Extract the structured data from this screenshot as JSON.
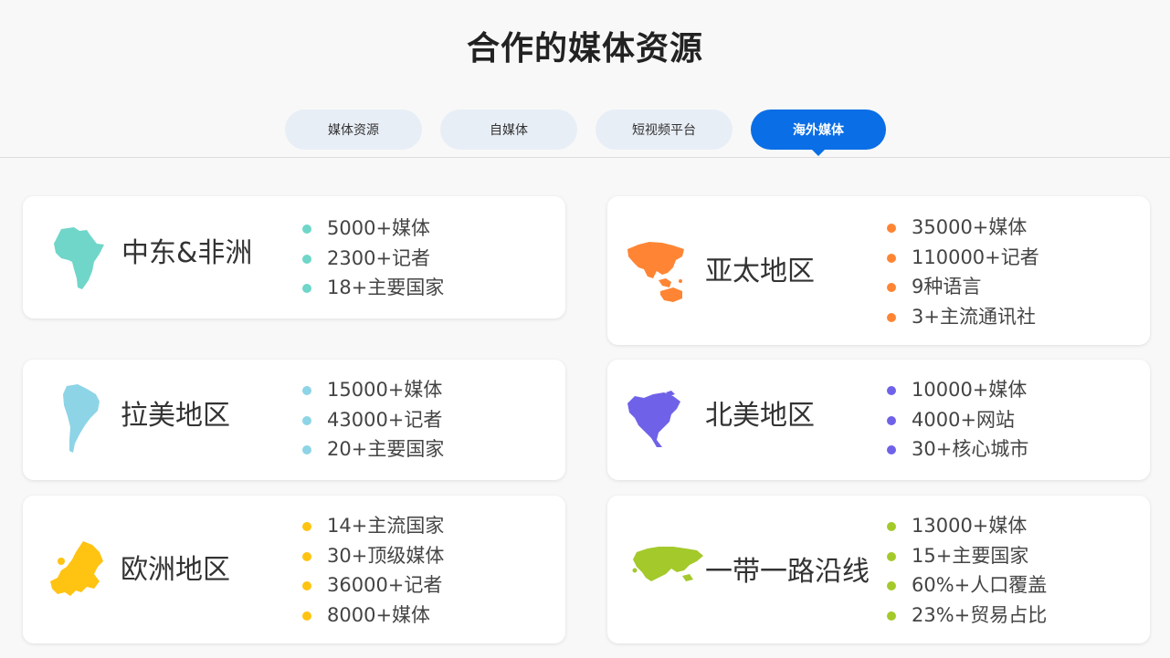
{
  "page": {
    "title": "合作的媒体资源"
  },
  "tabs": [
    {
      "label": "媒体资源",
      "active": false
    },
    {
      "label": "自媒体",
      "active": false
    },
    {
      "label": "短视频平台",
      "active": false
    },
    {
      "label": "海外媒体",
      "active": true
    }
  ],
  "accent_color": "#0a6ee6",
  "regions": [
    {
      "key": "middle-east-africa",
      "name": "中东&非洲",
      "color": "#6fd6c9",
      "map_icon": "africa-map-icon",
      "stats": [
        "5000+媒体",
        "2300+记者",
        "18+主要国家"
      ]
    },
    {
      "key": "asia-pacific",
      "name": "亚太地区",
      "color": "#ff8534",
      "map_icon": "asia-pacific-map-icon",
      "stats": [
        "35000+媒体",
        "110000+记者",
        "9种语言",
        "3+主流通讯社"
      ]
    },
    {
      "key": "latin-america",
      "name": "拉美地区",
      "color": "#8dd4e6",
      "map_icon": "south-america-map-icon",
      "stats": [
        "15000+媒体",
        "43000+记者",
        "20+主要国家"
      ]
    },
    {
      "key": "north-america",
      "name": "北美地区",
      "color": "#6f62e8",
      "map_icon": "north-america-map-icon",
      "stats": [
        "10000+媒体",
        "4000+网站",
        "30+核心城市"
      ]
    },
    {
      "key": "europe",
      "name": "欧洲地区",
      "color": "#ffc312",
      "map_icon": "europe-map-icon",
      "stats": [
        "14+主流国家",
        "30+顶级媒体",
        "36000+记者",
        "8000+媒体"
      ]
    },
    {
      "key": "belt-and-road",
      "name": "一带一路沿线",
      "color": "#a4c92b",
      "map_icon": "eurasia-map-icon",
      "stats": [
        "13000+媒体",
        "15+主要国家",
        "60%+人口覆盖",
        "23%+贸易占比"
      ]
    }
  ]
}
